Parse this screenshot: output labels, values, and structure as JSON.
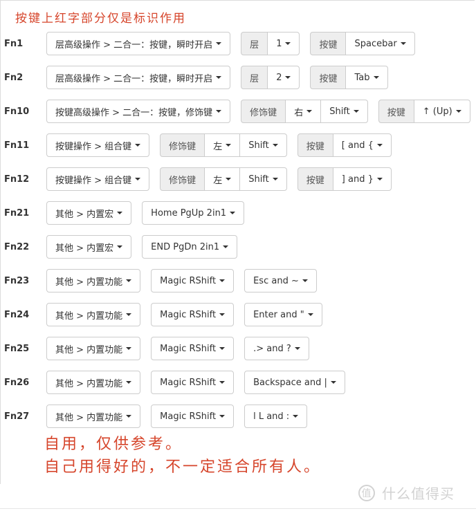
{
  "notes": {
    "top": "按键上红字部分仅是标识作用",
    "bottom_line1": "自用，仅供参考。",
    "bottom_line2": "自己用得好的，不一定适合所有人。",
    "color": "#d6452b"
  },
  "watermark": {
    "icon_char": "值",
    "text": "什么值得买"
  },
  "rows": [
    {
      "fn": "Fn1",
      "action": "层高级操作 > 二合一：按键，瞬时开启",
      "layer_label": "层",
      "layer_value": "1",
      "key_label": "按键",
      "key_value": "Spacebar"
    },
    {
      "fn": "Fn2",
      "action": "层高级操作 > 二合一：按键，瞬时开启",
      "layer_label": "层",
      "layer_value": "2",
      "key_label": "按键",
      "key_value": "Tab"
    },
    {
      "fn": "Fn10",
      "action": "按键高级操作 > 二合一：按键，修饰键",
      "mod_label": "修饰键",
      "mod_side": "右",
      "mod_key": "Shift",
      "key_label": "按键",
      "key_value": "↑ (Up)"
    },
    {
      "fn": "Fn11",
      "action": "按键操作 > 组合键",
      "mod_label": "修饰键",
      "mod_side": "左",
      "mod_key": "Shift",
      "key_label": "按键",
      "key_value": "[ and {"
    },
    {
      "fn": "Fn12",
      "action": "按键操作 > 组合键",
      "mod_label": "修饰键",
      "mod_side": "左",
      "mod_key": "Shift",
      "key_label": "按键",
      "key_value": "] and }"
    },
    {
      "fn": "Fn21",
      "action": "其他 > 内置宏",
      "macro": "Home PgUp 2in1"
    },
    {
      "fn": "Fn22",
      "action": "其他 > 内置宏",
      "macro": "END PgDn 2in1"
    },
    {
      "fn": "Fn23",
      "action": "其他 > 内置功能",
      "function": "Magic RShift",
      "param": "Esc and ~"
    },
    {
      "fn": "Fn24",
      "action": "其他 > 内置功能",
      "function": "Magic RShift",
      "param": "Enter and \""
    },
    {
      "fn": "Fn25",
      "action": "其他 > 内置功能",
      "function": "Magic RShift",
      "param": ".> and ?"
    },
    {
      "fn": "Fn26",
      "action": "其他 > 内置功能",
      "function": "Magic RShift",
      "param": "Backspace and |"
    },
    {
      "fn": "Fn27",
      "action": "其他 > 内置功能",
      "function": "Magic RShift",
      "param": "l L and :"
    }
  ]
}
